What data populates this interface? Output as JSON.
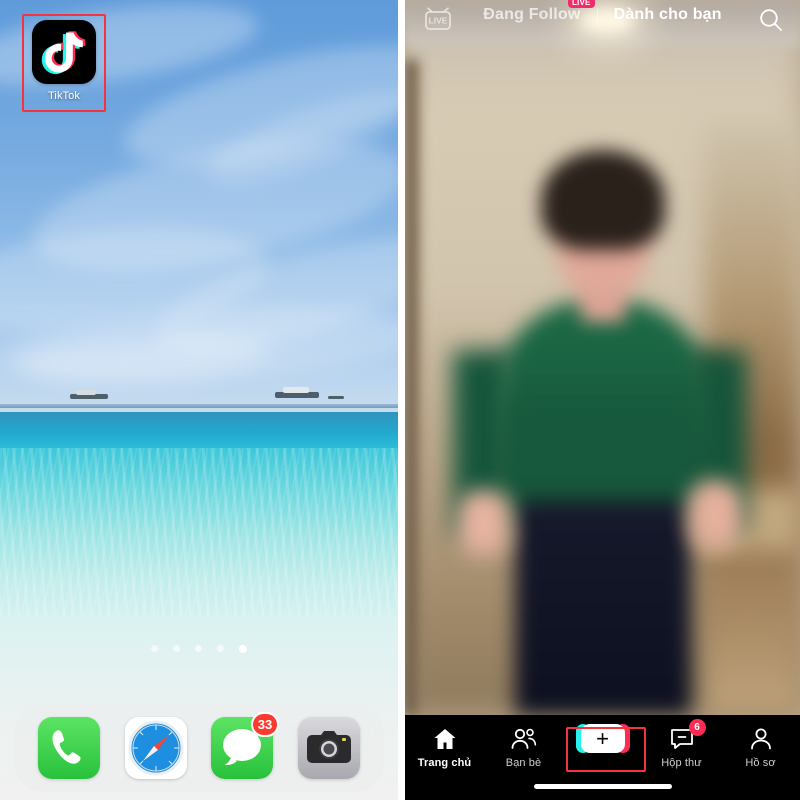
{
  "colors": {
    "highlight_red": "#f5333f",
    "tiktok_pink": "#fe2c55",
    "tiktok_cyan": "#28f0ea",
    "ios_badge_red": "#fc3b30",
    "live_badge_pink": "#f02c6a"
  },
  "home_screen": {
    "name": "ios-home-screen",
    "app": {
      "label": "TikTok",
      "icon_name": "tiktok-app-icon",
      "highlighted": true
    },
    "page_dots": {
      "count": 5,
      "active_index": 4
    },
    "dock": {
      "items": [
        {
          "icon_name": "phone-icon",
          "label": "Phone",
          "badge": ""
        },
        {
          "icon_name": "safari-icon",
          "label": "Safari",
          "badge": ""
        },
        {
          "icon_name": "messages-icon",
          "label": "Messages",
          "badge": "33"
        },
        {
          "icon_name": "camera-icon",
          "label": "Camera",
          "badge": ""
        }
      ]
    }
  },
  "tiktok": {
    "name": "tiktok-app",
    "top_bar": {
      "live_icon_name": "live-tv-icon",
      "live_icon_text": "LIVE",
      "tabs": [
        {
          "label": "Đang Follow",
          "active": false,
          "badge": "LIVE"
        },
        {
          "label": "Dành cho bạn",
          "active": true,
          "badge": ""
        }
      ],
      "search_icon_name": "search-icon"
    },
    "bottom_nav": {
      "items": [
        {
          "label": "Trang chủ",
          "icon_name": "home-icon",
          "active": true,
          "badge": ""
        },
        {
          "label": "Bạn bè",
          "icon_name": "friends-icon",
          "active": false,
          "badge": ""
        },
        {
          "label": "",
          "icon_name": "create-plus-button",
          "active": false,
          "badge": ""
        },
        {
          "label": "Hộp thư",
          "icon_name": "inbox-icon",
          "active": false,
          "badge": "6"
        },
        {
          "label": "Hồ sơ",
          "icon_name": "profile-icon",
          "active": false,
          "badge": ""
        }
      ],
      "highlighted_index": 2
    }
  }
}
